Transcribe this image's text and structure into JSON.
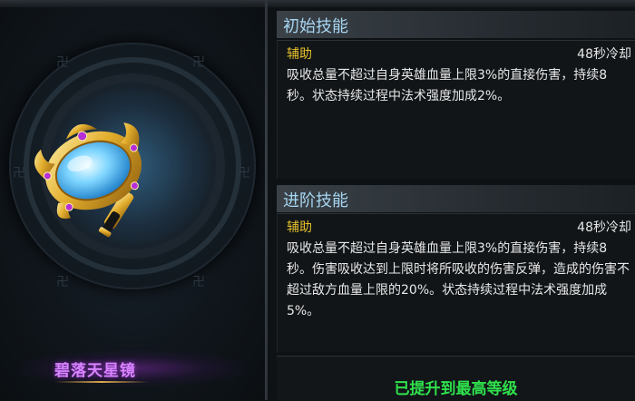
{
  "item": {
    "name": "碧落天星镜",
    "icon": "golden-hand-mirror"
  },
  "initial_skill": {
    "header": "初始技能",
    "type": "辅助",
    "cooldown": "48秒冷却",
    "description": "吸收总量不超过自身英雄血量上限3%的直接伤害，持续8秒。状态持续过程中法术强度加成2%。"
  },
  "advanced_skill": {
    "header": "进阶技能",
    "type": "辅助",
    "cooldown": "48秒冷却",
    "description": "吸收总量不超过自身英雄血量上限3%的直接伤害，持续8秒。伤害吸收达到上限时将所吸收的伤害反弹，造成的伤害不超过敌方血量上限的20%。状态持续过程中法术强度加成5%。"
  },
  "status": {
    "max_level_text": "已提升到最高等级"
  },
  "colors": {
    "header_text": "#a7d6f2",
    "skill_type": "#e9c12c",
    "item_name": "#d884ff",
    "max_level": "#2fe04c"
  }
}
